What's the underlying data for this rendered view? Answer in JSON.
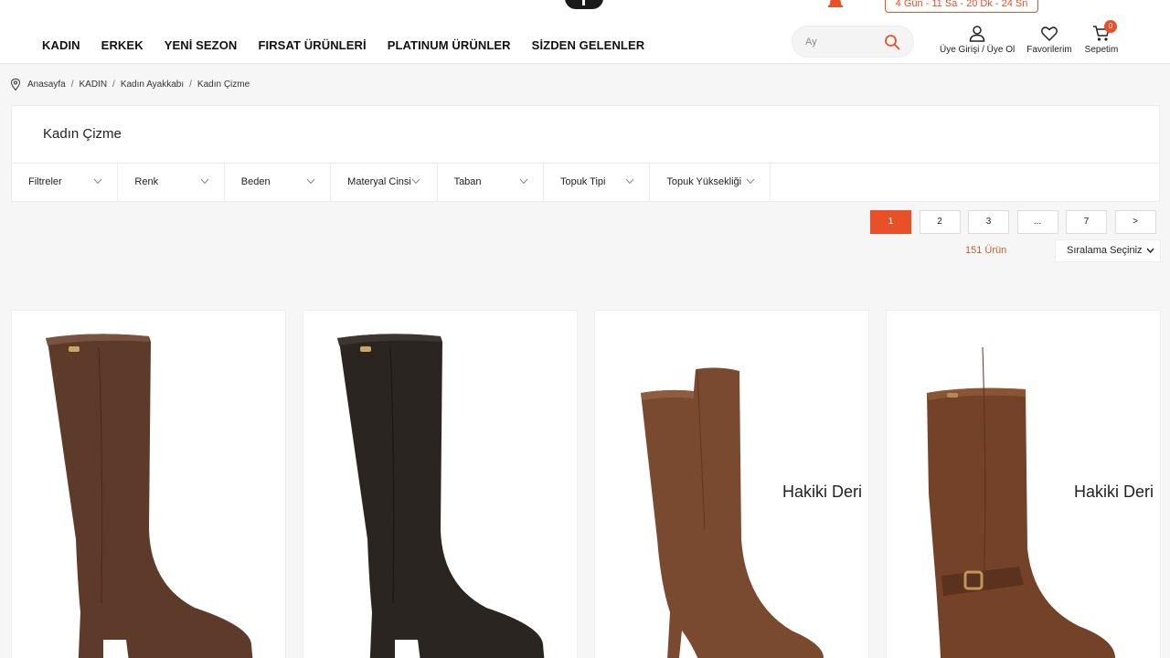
{
  "header": {
    "countdown": "4 Gün - 11 Sa - 20 Dk - 24 Sn",
    "nav": [
      "KADIN",
      "ERKEK",
      "YENİ SEZON",
      "FIRSAT ÜRÜNLERİ",
      "PLATINUM ÜRÜNLER",
      "SİZDEN GELENLER"
    ],
    "search_placeholder": "Ay",
    "account_label": "Üye Girişi / Üye Ol",
    "favorites_label": "Favorilerim",
    "cart_label": "Sepetim",
    "cart_count": "0"
  },
  "breadcrumb": [
    "Anasayfa",
    "KADIN",
    "Kadın Ayakkabı",
    "Kadın Çizme"
  ],
  "category": {
    "title": "Kadın Çizme",
    "filters": [
      "Filtreler",
      "Renk",
      "Beden",
      "Materyal Cinsi",
      "Taban",
      "Topuk Tipi",
      "Topuk Yüksekliği"
    ]
  },
  "pagination": {
    "pages": [
      "1",
      "2",
      "3",
      "...",
      "7",
      ">"
    ],
    "active": "1",
    "product_count": "151 Ürün",
    "sort_label": "Sıralama Seçiniz"
  },
  "products": [
    {
      "color": "#5e3a2a",
      "badge": ""
    },
    {
      "color": "#2a2520",
      "badge": ""
    },
    {
      "color": "#7a4a30",
      "badge": "Hakiki Deri"
    },
    {
      "color": "#744228",
      "badge": "Hakiki Deri"
    }
  ],
  "colors": {
    "accent": "#e8502a"
  }
}
